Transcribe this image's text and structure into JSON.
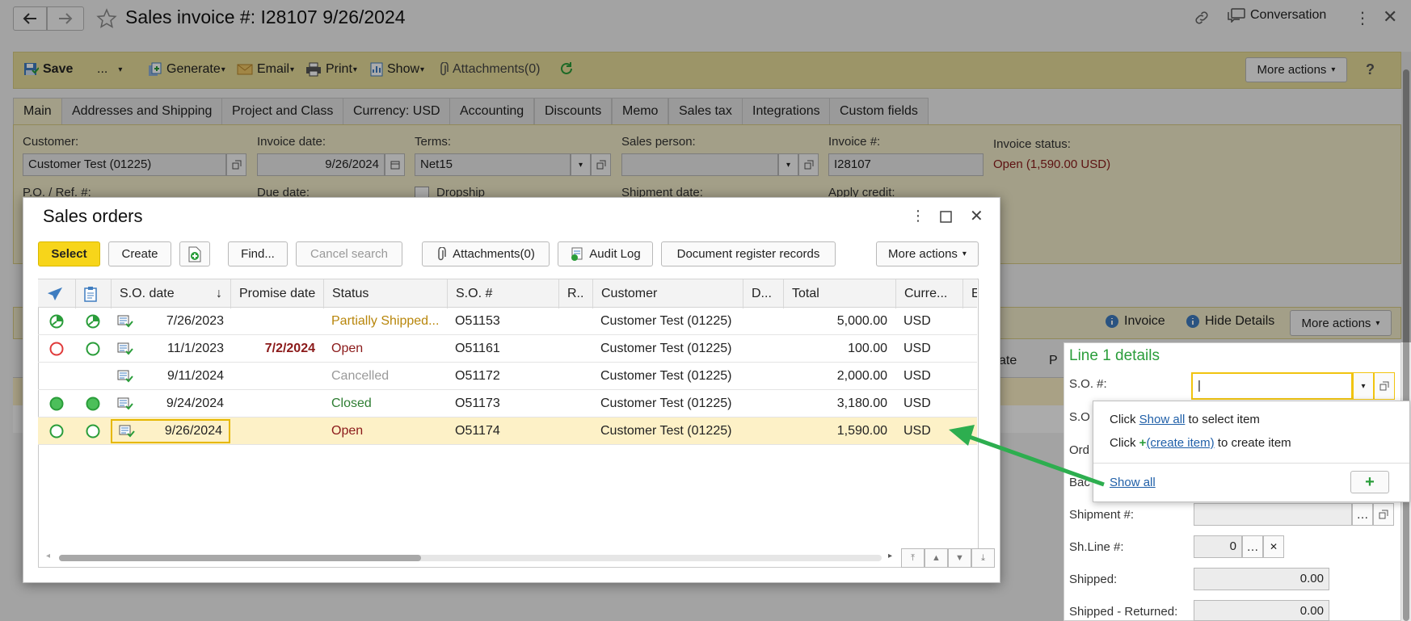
{
  "window": {
    "title": "Sales invoice #: I28107 9/26/2024",
    "conversation_label": "Conversation"
  },
  "toolbar": {
    "save_label": "Save",
    "dots_label": "...",
    "generate_label": "Generate",
    "email_label": "Email",
    "print_label": "Print",
    "show_label": "Show",
    "attachments_label": "Attachments(0)",
    "more_actions_label": "More actions",
    "help_label": "?"
  },
  "tabs": [
    {
      "label": "Main"
    },
    {
      "label": "Addresses and Shipping"
    },
    {
      "label": "Project and Class"
    },
    {
      "label": "Currency: USD"
    },
    {
      "label": "Accounting"
    },
    {
      "label": "Discounts"
    },
    {
      "label": "Memo"
    },
    {
      "label": "Sales tax"
    },
    {
      "label": "Integrations"
    },
    {
      "label": "Custom fields"
    }
  ],
  "form": {
    "customer_label": "Customer:",
    "customer_value": "Customer Test (01225)",
    "invoice_date_label": "Invoice date:",
    "invoice_date_value": "9/26/2024",
    "terms_label": "Terms:",
    "terms_value": "Net15",
    "sales_person_label": "Sales person:",
    "sales_person_value": "",
    "invoice_no_label": "Invoice #:",
    "invoice_no_value": "I28107",
    "invoice_status_label": "Invoice status:",
    "invoice_status_value": "Open (1,590.00 USD)",
    "po_label": "P.O. / Ref. #:",
    "due_date_label": "Due date:",
    "dropship_label": "Dropship",
    "shipment_date_label": "Shipment date:",
    "apply_credit_label": "Apply credit:"
  },
  "lines_toolbar": {
    "invoice_label": "Invoice",
    "hide_details_label": "Hide Details",
    "more_actions_label": "More actions",
    "partial_col_date": "ate",
    "partial_col_p": "P"
  },
  "line_details": {
    "title": "Line 1 details",
    "so_label": "S.O. #:",
    "so_value": "|",
    "so2_label": "S.O",
    "ord_label": "Ord",
    "bac_label": "Bac",
    "shipment_label": "Shipment #:",
    "shline_label": "Sh.Line #:",
    "shline_value": "0",
    "shipped_label": "Shipped:",
    "shipped_value": "0.00",
    "shipped_returned_label": "Shipped - Returned:",
    "shipped_returned_value": "0.00"
  },
  "popover": {
    "line1_prefix": "Click ",
    "line1_link": "Show all",
    "line1_suffix": " to select item",
    "line2_prefix": "Click ",
    "line2_link": "(create item)",
    "line2_suffix": " to create item",
    "show_all_link": "Show all",
    "plus_label": "+"
  },
  "dialog": {
    "title": "Sales orders",
    "buttons": {
      "select": "Select",
      "create": "Create",
      "find": "Find...",
      "cancel_search": "Cancel search",
      "attachments": "Attachments(0)",
      "audit_log": "Audit Log",
      "doc_register": "Document register records",
      "more_actions": "More actions"
    },
    "columns": {
      "so_date": "S.O. date",
      "promise_date": "Promise date",
      "status": "Status",
      "so_no": "S.O. #",
      "r": "R..",
      "customer": "Customer",
      "d": "D...",
      "total": "Total",
      "currency": "Curre...",
      "e": "E:"
    },
    "rows": [
      {
        "date": "7/26/2023",
        "promise": "",
        "status": "Partially Shipped...",
        "status_color": "#b8860b",
        "so": "O51153",
        "customer": "Customer Test (01225)",
        "total": "5,000.00",
        "currency": "USD",
        "icon1": "partial-clock",
        "icon2": "partial-clock"
      },
      {
        "date": "11/1/2023",
        "promise": "7/2/2024",
        "status": "Open",
        "status_color": "#8b1a1a",
        "so": "O51161",
        "customer": "Customer Test (01225)",
        "total": "100.00",
        "currency": "USD",
        "icon1": "red-ring",
        "icon2": "green-ring"
      },
      {
        "date": "9/11/2024",
        "promise": "",
        "status": "Cancelled",
        "status_color": "#9a9a9a",
        "so": "O51172",
        "customer": "Customer Test (01225)",
        "total": "2,000.00",
        "currency": "USD",
        "icon1": "",
        "icon2": ""
      },
      {
        "date": "9/24/2024",
        "promise": "",
        "status": "Closed",
        "status_color": "#2e7d32",
        "so": "O51173",
        "customer": "Customer Test (01225)",
        "total": "3,180.00",
        "currency": "USD",
        "icon1": "green-dot",
        "icon2": "green-dot"
      },
      {
        "date": "9/26/2024",
        "promise": "",
        "status": "Open",
        "status_color": "#8b1a1a",
        "so": "O51174",
        "customer": "Customer Test (01225)",
        "total": "1,590.00",
        "currency": "USD",
        "icon1": "green-ring",
        "icon2": "green-ring"
      }
    ]
  },
  "colors": {
    "accent_yellow": "#f7d51a",
    "toolbar_bg": "#e9df9b",
    "form_bg": "#f3eecb",
    "link_green": "#2a9d3a",
    "selected_row": "#fdf1c7",
    "arrow_green": "#2dae4f"
  }
}
